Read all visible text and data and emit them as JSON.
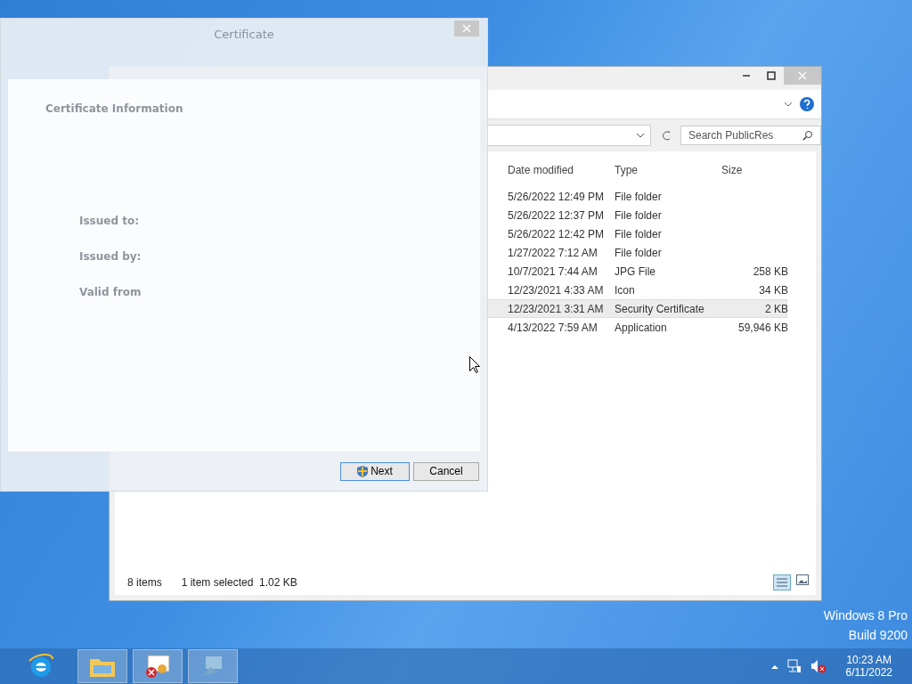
{
  "desktop": {
    "edition": [
      "Windows 8 Pro",
      "Build 9200"
    ]
  },
  "explorer": {
    "search": {
      "placeholder": "Search PublicRes"
    },
    "columns": [
      "Date modified",
      "Type",
      "Size"
    ],
    "rows": [
      {
        "date": "5/26/2022 12:49 PM",
        "type": "File folder",
        "size": "",
        "selected": false
      },
      {
        "date": "5/26/2022 12:37 PM",
        "type": "File folder",
        "size": "",
        "selected": false
      },
      {
        "date": "5/26/2022 12:42 PM",
        "type": "File folder",
        "size": "",
        "selected": false
      },
      {
        "date": "1/27/2022 7:12 AM",
        "type": "File folder",
        "size": "",
        "selected": false
      },
      {
        "date": "10/7/2021 7:44 AM",
        "type": "JPG File",
        "size": "258 KB",
        "selected": false
      },
      {
        "date": "12/23/2021 4:33 AM",
        "type": "Icon",
        "size": "34 KB",
        "selected": false
      },
      {
        "date": "12/23/2021 3:31 AM",
        "type": "Security Certificate",
        "size": "2 KB",
        "selected": true
      },
      {
        "date": "4/13/2022 7:59 AM",
        "type": "Application",
        "size": "59,946 KB",
        "selected": false
      }
    ],
    "status": {
      "count": "8 items",
      "selection": "1 item selected  1.02 KB"
    }
  },
  "dialog": {
    "title": "Certificate",
    "heading": "Certificate Information",
    "fields": [
      "Issued to:",
      "Issued by:",
      "Valid from"
    ],
    "buttons": [
      {
        "label": "Next",
        "kind": "shield"
      },
      {
        "label": "Cancel",
        "kind": "plain"
      }
    ]
  },
  "taskbar": {
    "clock": {
      "time": "10:23 AM",
      "date": "6/11/2022"
    }
  }
}
